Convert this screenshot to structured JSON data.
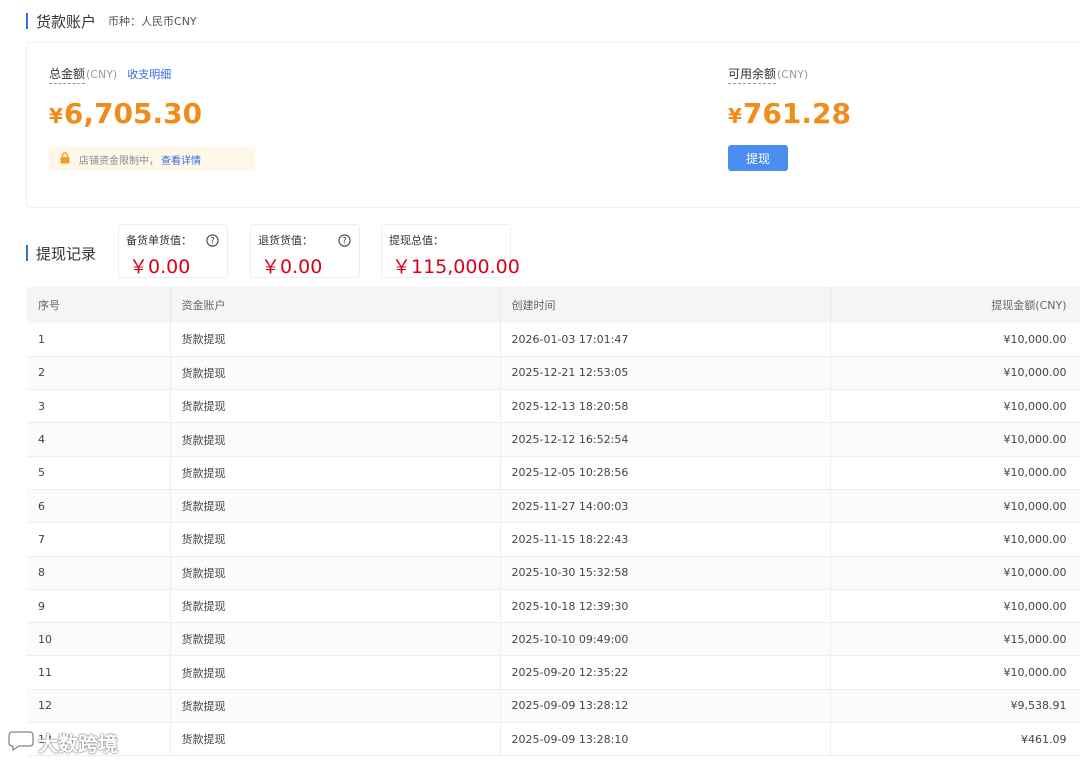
{
  "account": {
    "title": "货款账户",
    "currency_label": "币种：人民币CNY"
  },
  "summary": {
    "total": {
      "label": "总金额",
      "unit": "(CNY)",
      "link": "收支明细",
      "currency_symbol": "¥",
      "amount": "6,705.30"
    },
    "notice": {
      "text": "店铺资金限制中，",
      "link": "查看详情"
    },
    "available": {
      "label": "可用余额",
      "unit": "(CNY)",
      "currency_symbol": "¥",
      "amount": "761.28"
    },
    "withdraw_button": "提现"
  },
  "records": {
    "title": "提现记录",
    "stats": [
      {
        "label": "备货单货值：",
        "value": "￥0.00",
        "has_help": true
      },
      {
        "label": "退货货值：",
        "value": "￥0.00",
        "has_help": true
      },
      {
        "label": "提现总值：",
        "value": "￥115,000.00",
        "has_help": false
      }
    ],
    "columns": [
      "序号",
      "资金账户",
      "创建时间",
      "提现金额(CNY)"
    ],
    "rows": [
      [
        "1",
        "货款提现",
        "2026-01-03 17:01:47",
        "¥10,000.00"
      ],
      [
        "2",
        "货款提现",
        "2025-12-21 12:53:05",
        "¥10,000.00"
      ],
      [
        "3",
        "货款提现",
        "2025-12-13 18:20:58",
        "¥10,000.00"
      ],
      [
        "4",
        "货款提现",
        "2025-12-12 16:52:54",
        "¥10,000.00"
      ],
      [
        "5",
        "货款提现",
        "2025-12-05 10:28:56",
        "¥10,000.00"
      ],
      [
        "6",
        "货款提现",
        "2025-11-27 14:00:03",
        "¥10,000.00"
      ],
      [
        "7",
        "货款提现",
        "2025-11-15 18:22:43",
        "¥10,000.00"
      ],
      [
        "8",
        "货款提现",
        "2025-10-30 15:32:58",
        "¥10,000.00"
      ],
      [
        "9",
        "货款提现",
        "2025-10-18 12:39:30",
        "¥10,000.00"
      ],
      [
        "10",
        "货款提现",
        "2025-10-10 09:49:00",
        "¥15,000.00"
      ],
      [
        "11",
        "货款提现",
        "2025-09-20 12:35:22",
        "¥10,000.00"
      ],
      [
        "12",
        "货款提现",
        "2025-09-09 13:28:12",
        "¥9,538.91"
      ],
      [
        "13",
        "货款提现",
        "2025-09-09 13:28:10",
        "¥461.09"
      ]
    ]
  },
  "watermark": {
    "text": "大数跨境"
  },
  "colors": {
    "accent": "#2f6fe0",
    "amount": "#f08c1c",
    "stat_value": "#d9001b",
    "button": "#4a8ff0"
  }
}
